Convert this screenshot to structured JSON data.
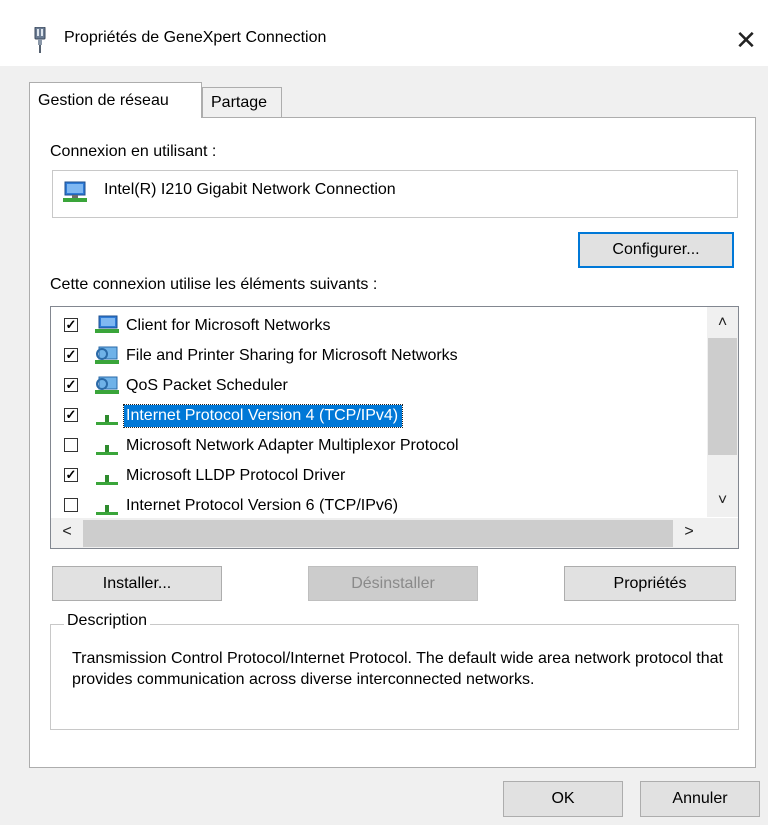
{
  "window": {
    "title": "Propriétés de GeneXpert Connection",
    "close_glyph": "✕",
    "icon": "network-adapter-title-icon"
  },
  "tabs": [
    {
      "label": "Gestion de réseau",
      "active": true
    },
    {
      "label": "Partage",
      "active": false
    }
  ],
  "connect_using": {
    "label": "Connexion en utilisant :",
    "adapter_name": "Intel(R) I210 Gigabit Network Connection",
    "adapter_icon": "network-adapter-icon"
  },
  "configure_label": "Configurer...",
  "items_label": "Cette connexion utilise les éléments suivants :",
  "items": [
    {
      "label": "Client for Microsoft Networks",
      "checked": true,
      "icon": "network-client-icon",
      "selected": false
    },
    {
      "label": "File and Printer Sharing for Microsoft Networks",
      "checked": true,
      "icon": "network-service-icon",
      "selected": false
    },
    {
      "label": "QoS Packet Scheduler",
      "checked": true,
      "icon": "network-service-icon",
      "selected": false
    },
    {
      "label": "Internet Protocol Version 4 (TCP/IPv4)",
      "checked": true,
      "icon": "protocol-icon",
      "selected": true
    },
    {
      "label": "Microsoft Network Adapter Multiplexor Protocol",
      "checked": false,
      "icon": "protocol-icon",
      "selected": false
    },
    {
      "label": "Microsoft LLDP Protocol Driver",
      "checked": true,
      "icon": "protocol-icon",
      "selected": false
    },
    {
      "label": "Internet Protocol Version 6 (TCP/IPv6)",
      "checked": false,
      "icon": "protocol-icon",
      "selected": false
    }
  ],
  "scroll_arrows": {
    "up": "˄",
    "down": "˅",
    "left": "<",
    "right": ">"
  },
  "actions": {
    "install_label": "Installer...",
    "uninstall_label": "Désinstaller",
    "uninstall_disabled": true,
    "properties_label": "Propriétés"
  },
  "description": {
    "legend": "Description",
    "text": "Transmission Control Protocol/Internet Protocol. The default wide area network protocol that provides communication across diverse interconnected networks."
  },
  "footer": {
    "ok_label": "OK",
    "cancel_label": "Annuler"
  },
  "colors": {
    "accent": "#0078d7",
    "selection": "#0078d7",
    "window_bg": "#f0f0f0",
    "panel_bg": "#ffffff"
  }
}
